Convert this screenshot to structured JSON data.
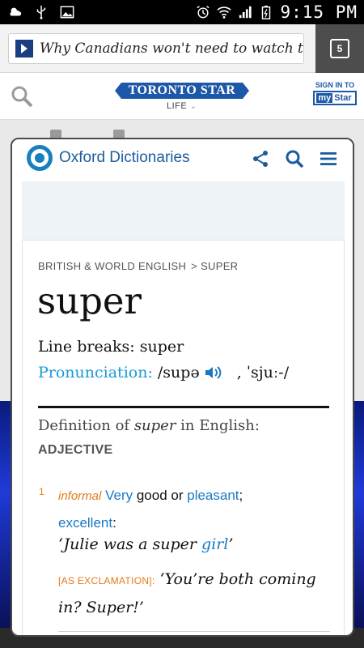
{
  "status_bar": {
    "time": "9:15 PM",
    "icons": [
      "weather-icon",
      "usb-icon",
      "image-icon",
      "alarm-icon",
      "wifi-icon",
      "signal-icon",
      "battery-icon"
    ]
  },
  "browser": {
    "url_text": "Why Canadians won't need to watch th",
    "tab_count": "5"
  },
  "site_header": {
    "logo": "TORONTO STAR",
    "section": "LIFE",
    "signin_label": "SIGN IN TO",
    "mystar_my": "my",
    "mystar_star": "Star"
  },
  "dictionary": {
    "brand": "Oxford Dictionaries",
    "breadcrumb_root": "BRITISH & WORLD ENGLISH",
    "breadcrumb_sep": ">",
    "breadcrumb_leaf": "SUPER",
    "headword": "super",
    "line_breaks": "Line breaks: super",
    "pronunciation_label": "Pronunciation:",
    "pronunciation_ipa": "/supə",
    "pronunciation_ipa_alt": ", ˈsjuː-/",
    "definition_prefix": "Definition of ",
    "definition_word": "super",
    "definition_suffix": " in English:",
    "part_of_speech": "ADJECTIVE",
    "sense": {
      "number": "1",
      "register": "informal",
      "word1": "Very",
      "text1": " good or ",
      "word2": "pleasant",
      "text2": ";",
      "word3": "excellent",
      "text3": ":"
    },
    "example1_pre": "‘Julie was a super ",
    "example1_link": "girl",
    "example1_post": "’",
    "example2_tag": "[AS EXCLAMATION]:",
    "example2_text": "‘You’re both coming in? Super!’"
  },
  "colors": {
    "oxford_blue": "#1a5c9e",
    "link_blue": "#1a78c2",
    "pron_cyan": "#1a9ad6",
    "register_orange": "#e07b1a",
    "star_blue": "#1d58a8"
  }
}
